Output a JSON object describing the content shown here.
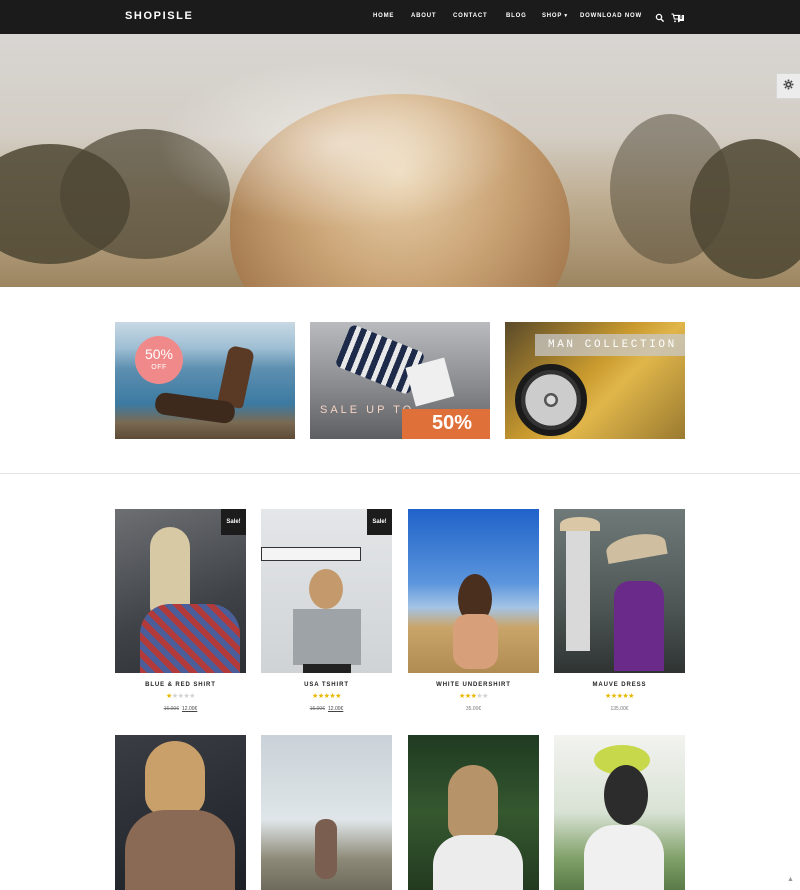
{
  "brand": "SHOPISLE",
  "nav": [
    {
      "label": "HOME"
    },
    {
      "label": "ABOUT"
    },
    {
      "label": "CONTACT"
    },
    {
      "label": "BLOG"
    },
    {
      "label": "SHOP"
    },
    {
      "label": "DOWNLOAD NOW"
    }
  ],
  "cart_count": "0",
  "icons": {
    "search": "search-icon",
    "cart": "cart-icon",
    "settings": "gear-icon",
    "scroll": "chevron-up-icon"
  },
  "banners": {
    "off_badge": {
      "big": "50%",
      "small": "OFF"
    },
    "sale": {
      "text": "SALE UP TO",
      "percent": "50%"
    },
    "man": {
      "text": "MAN COLLECTION"
    }
  },
  "products": [
    {
      "name": "BLUE & RED SHIRT",
      "badge": "Sale!",
      "rating": 1,
      "old_price": "16.00€",
      "price": "12.00€"
    },
    {
      "name": "USA TSHIRT",
      "badge": "Sale!",
      "rating": 4.5,
      "old_price": "15.00€",
      "price": "12.00€"
    },
    {
      "name": "WHITE UNDERSHIRT",
      "badge": "",
      "rating": 3,
      "old_price": "",
      "price": "35.00€"
    },
    {
      "name": "MAUVE DRESS",
      "badge": "",
      "rating": 5,
      "old_price": "",
      "price": "135.00€"
    },
    {
      "name": "",
      "badge": "",
      "rating": 0,
      "old_price": "",
      "price": ""
    },
    {
      "name": "",
      "badge": "",
      "rating": 0,
      "old_price": "",
      "price": ""
    },
    {
      "name": "",
      "badge": "",
      "rating": 0,
      "old_price": "",
      "price": ""
    },
    {
      "name": "",
      "badge": "",
      "rating": 0,
      "old_price": "",
      "price": ""
    }
  ],
  "colors": {
    "nav_bg": "#1b1b1b",
    "sale_orange": "#e0703a",
    "badge_pink": "#f08a8a",
    "star": "#e6b800"
  }
}
